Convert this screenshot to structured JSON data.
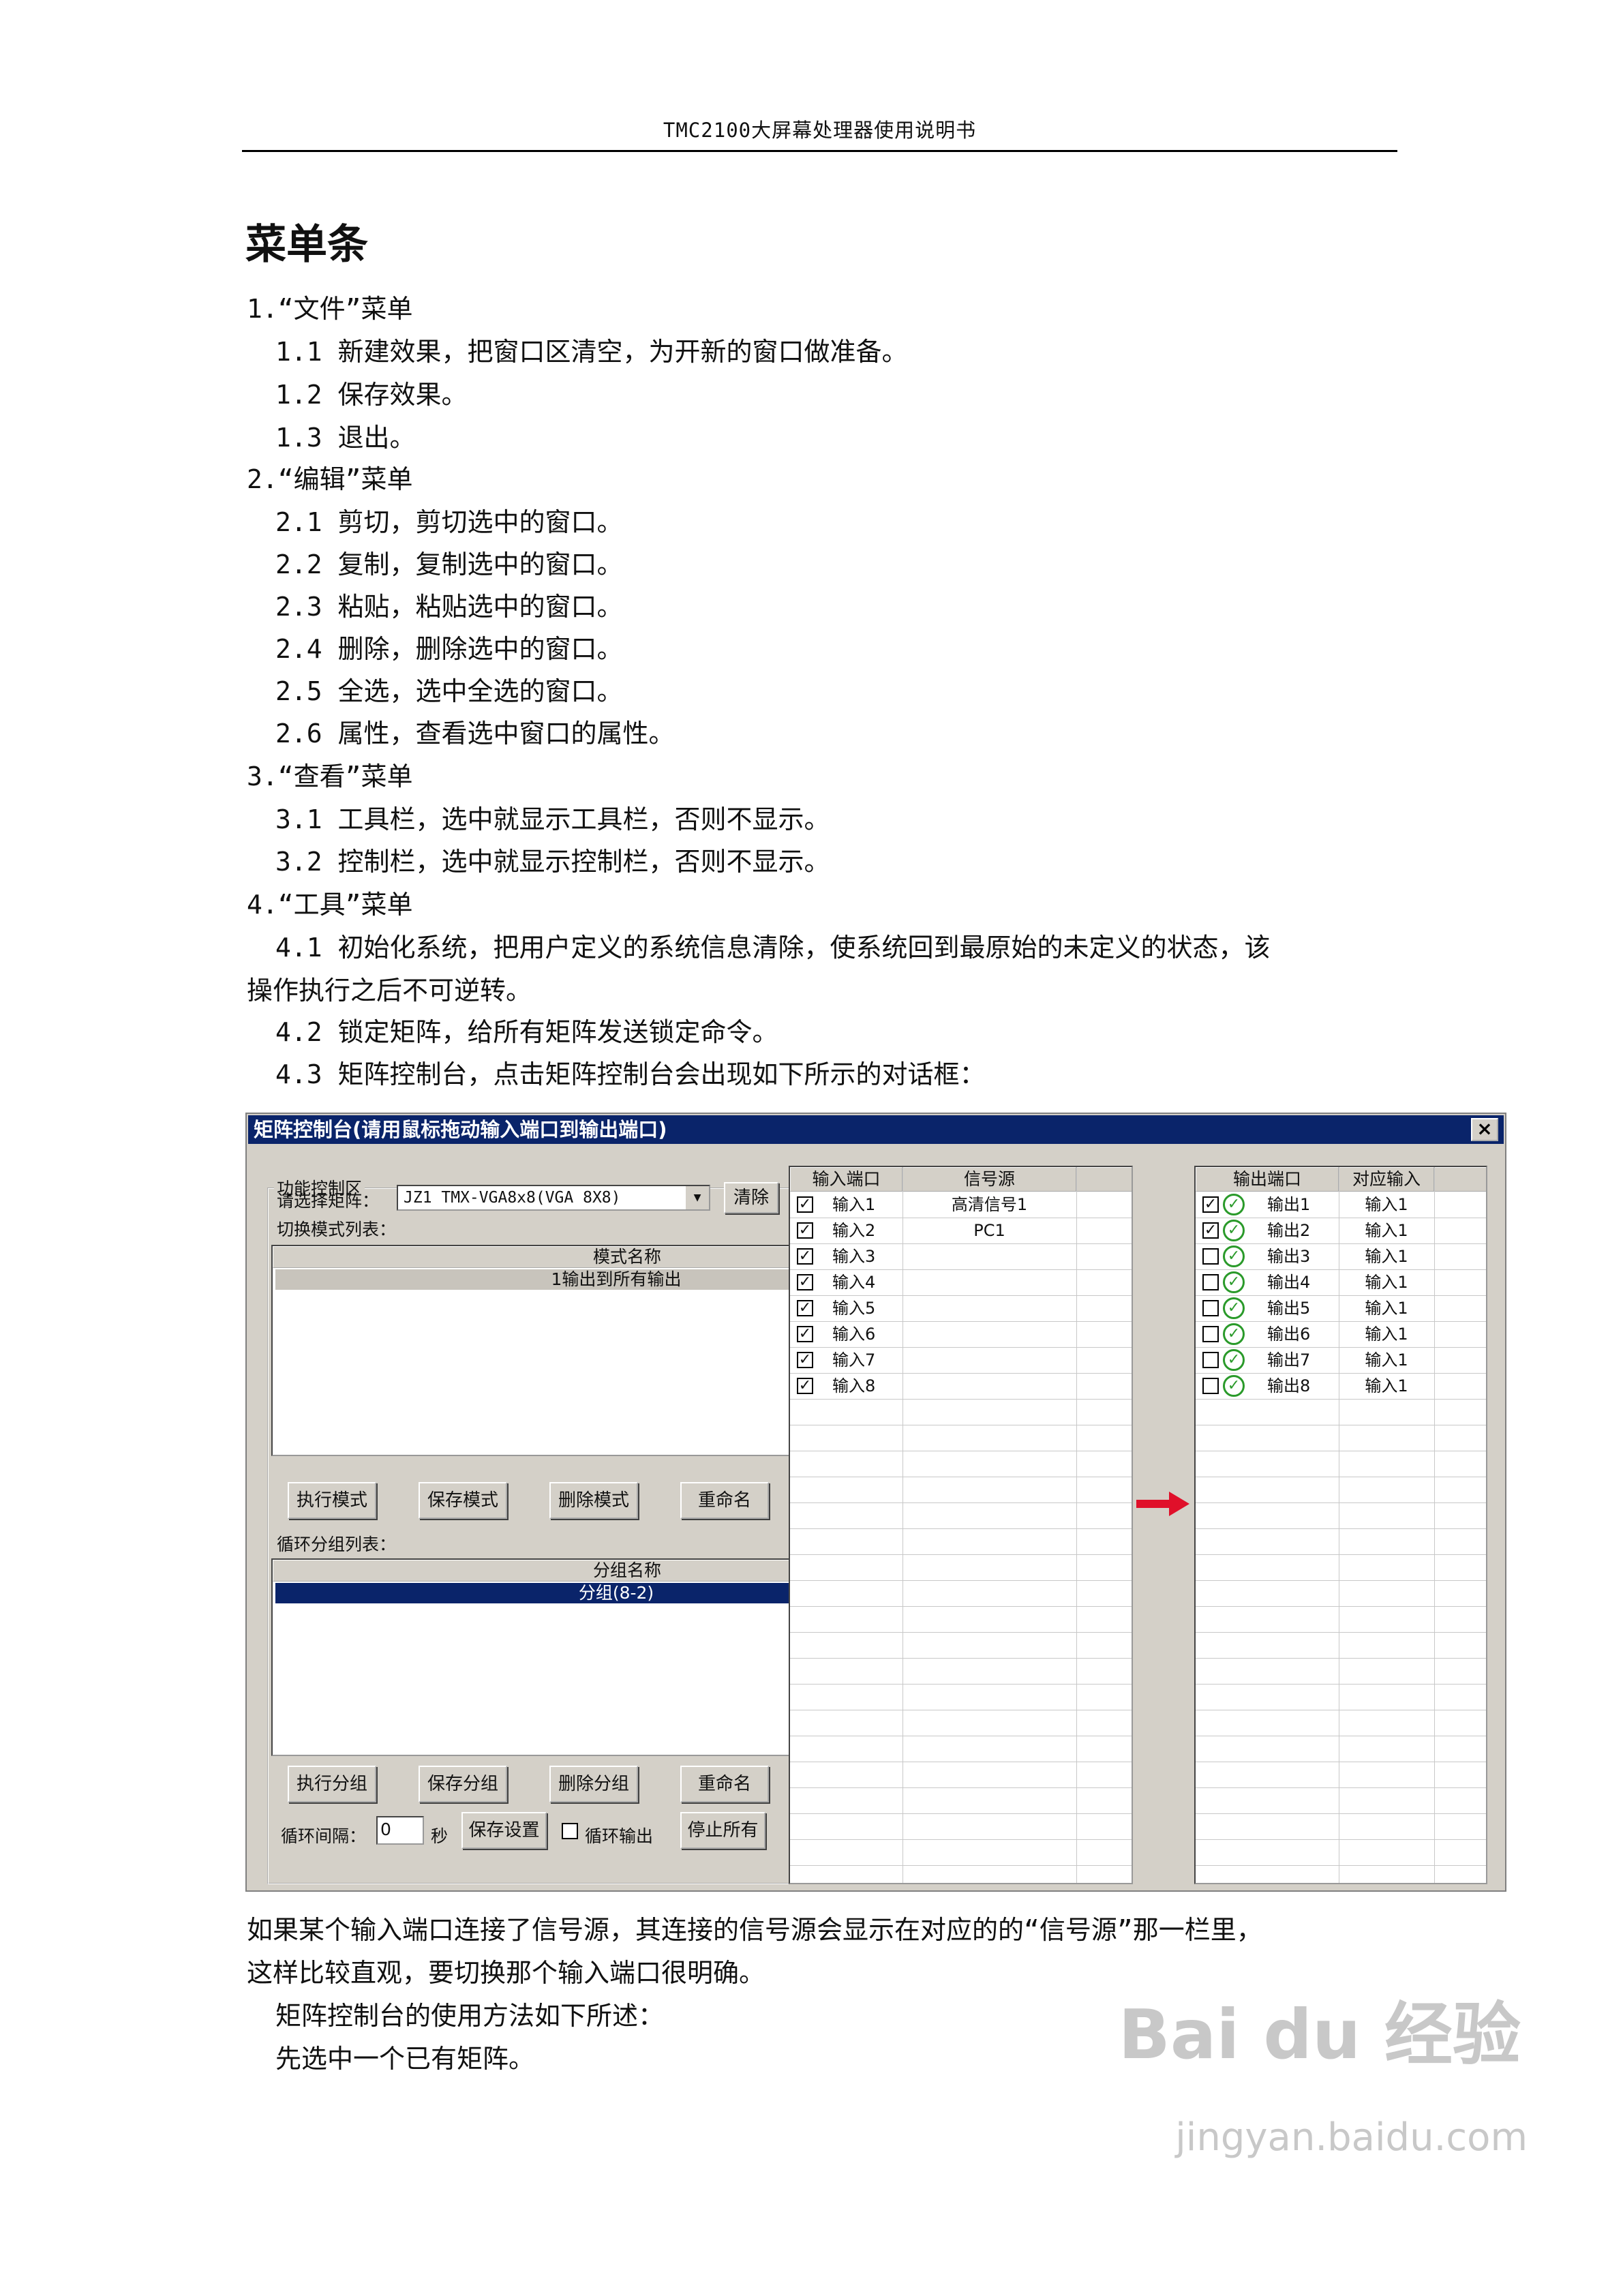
{
  "header": "TMC2100大屏幕处理器使用说明书",
  "section_title": "菜单条",
  "lines": [
    "1.“文件”菜单",
    "1.1 新建效果，把窗口区清空，为开新的窗口做准备。",
    "1.2 保存效果。",
    "1.3 退出。",
    "2.“编辑”菜单",
    "2.1 剪切，剪切选中的窗口。",
    "2.2 复制，复制选中的窗口。",
    "2.3 粘贴，粘贴选中的窗口。",
    "2.4 删除，删除选中的窗口。",
    "2.5 全选，选中全选的窗口。",
    "2.6 属性，查看选中窗口的属性。",
    "3.“查看”菜单",
    "3.1 工具栏，选中就显示工具栏，否则不显示。",
    "3.2 控制栏，选中就显示控制栏，否则不显示。",
    "4.“工具”菜单",
    "4.1 初始化系统，把用户定义的系统信息清除，使系统回到最原始的未定义的状态，该",
    "操作执行之后不可逆转。",
    "4.2 锁定矩阵，给所有矩阵发送锁定命令。",
    "4.3 矩阵控制台，点击矩阵控制台会出现如下所示的对话框："
  ],
  "dialog": {
    "title": "矩阵控制台(请用鼠标拖动输入端口到输出端口)",
    "close": "×",
    "group_label": "功能控制区",
    "select_matrix_label": "请选择矩阵：",
    "matrix_value": "JZ1  TMX-VGA8x8(VGA 8X8)",
    "clear_button": "清除",
    "mode_list_label": "切换模式列表：",
    "mode_header": "模式名称",
    "modes": [
      "1输出到所有输出"
    ],
    "mode_buttons": [
      "执行模式",
      "保存模式",
      "删除模式",
      "重命名"
    ],
    "group_list_label": "循环分组列表：",
    "group_header": "分组名称",
    "groups": [
      "分组(8-2)"
    ],
    "group_buttons": [
      "执行分组",
      "保存分组",
      "删除分组",
      "重命名"
    ],
    "interval_label": "循环间隔：",
    "interval_value": "0",
    "interval_unit": "秒",
    "save_settings": "保存设置",
    "cycle_output": "循环输出",
    "stop_all": "停止所有",
    "input_headers": [
      "输入端口",
      "信号源"
    ],
    "inputs": [
      {
        "port": "输入1",
        "source": "高清信号1"
      },
      {
        "port": "输入2",
        "source": "PC1"
      },
      {
        "port": "输入3",
        "source": ""
      },
      {
        "port": "输入4",
        "source": ""
      },
      {
        "port": "输入5",
        "source": ""
      },
      {
        "port": "输入6",
        "source": ""
      },
      {
        "port": "输入7",
        "source": ""
      },
      {
        "port": "输入8",
        "source": ""
      }
    ],
    "output_headers": [
      "输出端口",
      "对应输入"
    ],
    "outputs": [
      {
        "port": "输出1",
        "input": "输入1",
        "checked": true
      },
      {
        "port": "输出2",
        "input": "输入1",
        "checked": true
      },
      {
        "port": "输出3",
        "input": "输入1",
        "checked": false
      },
      {
        "port": "输出4",
        "input": "输入1",
        "checked": false
      },
      {
        "port": "输出5",
        "input": "输入1",
        "checked": false
      },
      {
        "port": "输出6",
        "input": "输入1",
        "checked": false
      },
      {
        "port": "输出7",
        "input": "输入1",
        "checked": false
      },
      {
        "port": "输出8",
        "input": "输入1",
        "checked": false
      }
    ]
  },
  "after_lines": [
    "如果某个输入端口连接了信号源，其连接的信号源会显示在对应的的“信号源”那一栏里，",
    "这样比较直观，要切换那个输入端口很明确。",
    "矩阵控制台的使用方法如下所述：",
    "先选中一个已有矩阵。"
  ],
  "watermark": "Bai du 经验",
  "watermark_url": "jingyan.baidu.com"
}
